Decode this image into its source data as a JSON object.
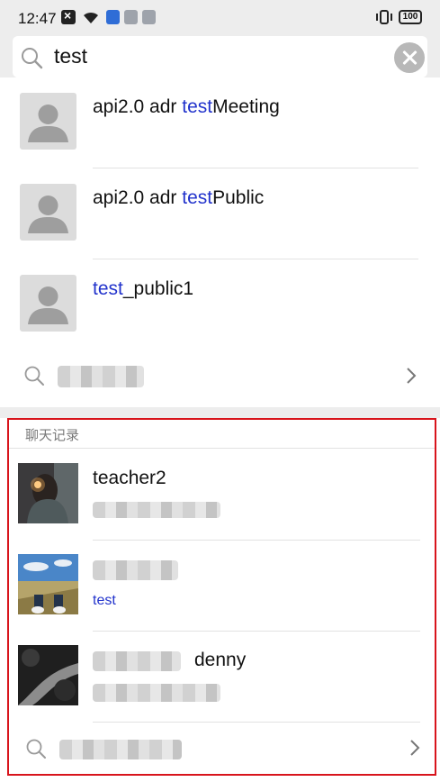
{
  "status_bar": {
    "time": "12:47",
    "battery": "100"
  },
  "search": {
    "query": "test",
    "placeholder": ""
  },
  "contacts": [
    {
      "prefix": "api2.0 adr ",
      "match": "test",
      "suffix": "Meeting"
    },
    {
      "prefix": "api2.0 adr ",
      "match": "test",
      "suffix": "Public"
    },
    {
      "prefix": "",
      "match": "test",
      "suffix": "_public1"
    }
  ],
  "chat_section": {
    "header": "聊天记录",
    "rows": [
      {
        "title": "teacher2",
        "subtitle": ""
      },
      {
        "title": "",
        "subtitle": "test"
      },
      {
        "title": "denny",
        "subtitle": ""
      }
    ]
  },
  "colors": {
    "highlight": "#2233cc",
    "annotation_box": "#d8141c",
    "background_gray": "#ededed"
  }
}
